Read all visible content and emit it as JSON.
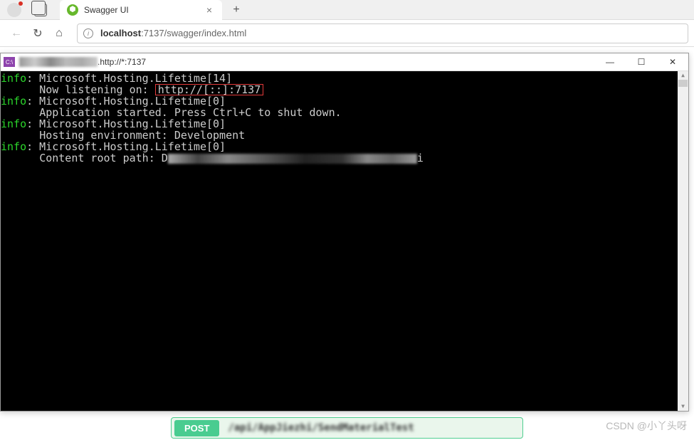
{
  "browser": {
    "tab_title": "Swagger UI",
    "url_display_host": "localhost",
    "url_display_path": ":7137/swagger/index.html"
  },
  "console": {
    "title": ".http://*:7137",
    "icon_text": "C:\\",
    "lines": [
      {
        "level": "info",
        "text": ": Microsoft.Hosting.Lifetime[14]"
      },
      {
        "indent": "      ",
        "prefix": "Now listening on: ",
        "highlight": "http://[::]:7137"
      },
      {
        "level": "info",
        "text": ": Microsoft.Hosting.Lifetime[0]"
      },
      {
        "indent": "      ",
        "text": "Application started. Press Ctrl+C to shut down."
      },
      {
        "level": "info",
        "text": ": Microsoft.Hosting.Lifetime[0]"
      },
      {
        "indent": "      ",
        "text": "Hosting environment: Development"
      },
      {
        "level": "info",
        "text": ": Microsoft.Hosting.Lifetime[0]"
      },
      {
        "indent": "      ",
        "prefix": "Content root path: D",
        "blur_after": true,
        "trailing": "i"
      }
    ],
    "win_controls": {
      "minimize": "—",
      "maximize": "☐",
      "close": "✕"
    }
  },
  "swagger": {
    "method": "POST",
    "path": "/api/AppJiezhi/SendMaterialTest"
  },
  "watermark": "CSDN @小丫头呀"
}
